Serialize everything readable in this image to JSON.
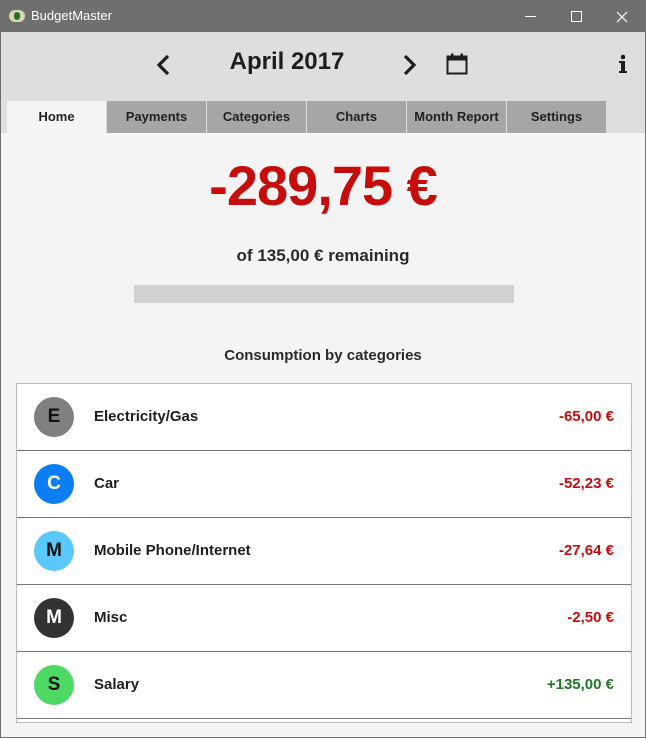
{
  "window": {
    "title": "BudgetMaster"
  },
  "header": {
    "month_label": "April 2017",
    "prev_icon": "chevron-left-icon",
    "next_icon": "chevron-right-icon",
    "calendar_icon": "calendar-icon",
    "info_icon": "info-icon"
  },
  "tabs": [
    {
      "label": "Home",
      "active": true
    },
    {
      "label": "Payments",
      "active": false
    },
    {
      "label": "Categories",
      "active": false
    },
    {
      "label": "Charts",
      "active": false
    },
    {
      "label": "Month Report",
      "active": false
    },
    {
      "label": "Settings",
      "active": false
    }
  ],
  "home": {
    "balance": "-289,75 €",
    "remaining_text": "of 135,00 € remaining",
    "remaining_fraction": 0,
    "section_title": "Consumption by categories"
  },
  "colors": {
    "negative": "#c70c0c",
    "positive": "#1f7a24",
    "tab_active": "#f4f4f4",
    "tab_inactive": "#a6a6a6"
  },
  "categories": [
    {
      "initial": "E",
      "name": "Electricity/Gas",
      "amount": "-65,00 €",
      "color": "#808080",
      "text_color": "#111111",
      "sign": "negative"
    },
    {
      "initial": "C",
      "name": "Car",
      "amount": "-52,23 €",
      "color": "#0a7ef2",
      "text_color": "#ffffff",
      "sign": "negative"
    },
    {
      "initial": "M",
      "name": "Mobile Phone/Internet",
      "amount": "-27,64 €",
      "color": "#5ac8fa",
      "text_color": "#111111",
      "sign": "negative"
    },
    {
      "initial": "M",
      "name": "Misc",
      "amount": "-2,50 €",
      "color": "#333333",
      "text_color": "#ffffff",
      "sign": "negative"
    },
    {
      "initial": "S",
      "name": "Salary",
      "amount": "+135,00 €",
      "color": "#4cd964",
      "text_color": "#111111",
      "sign": "positive"
    }
  ]
}
